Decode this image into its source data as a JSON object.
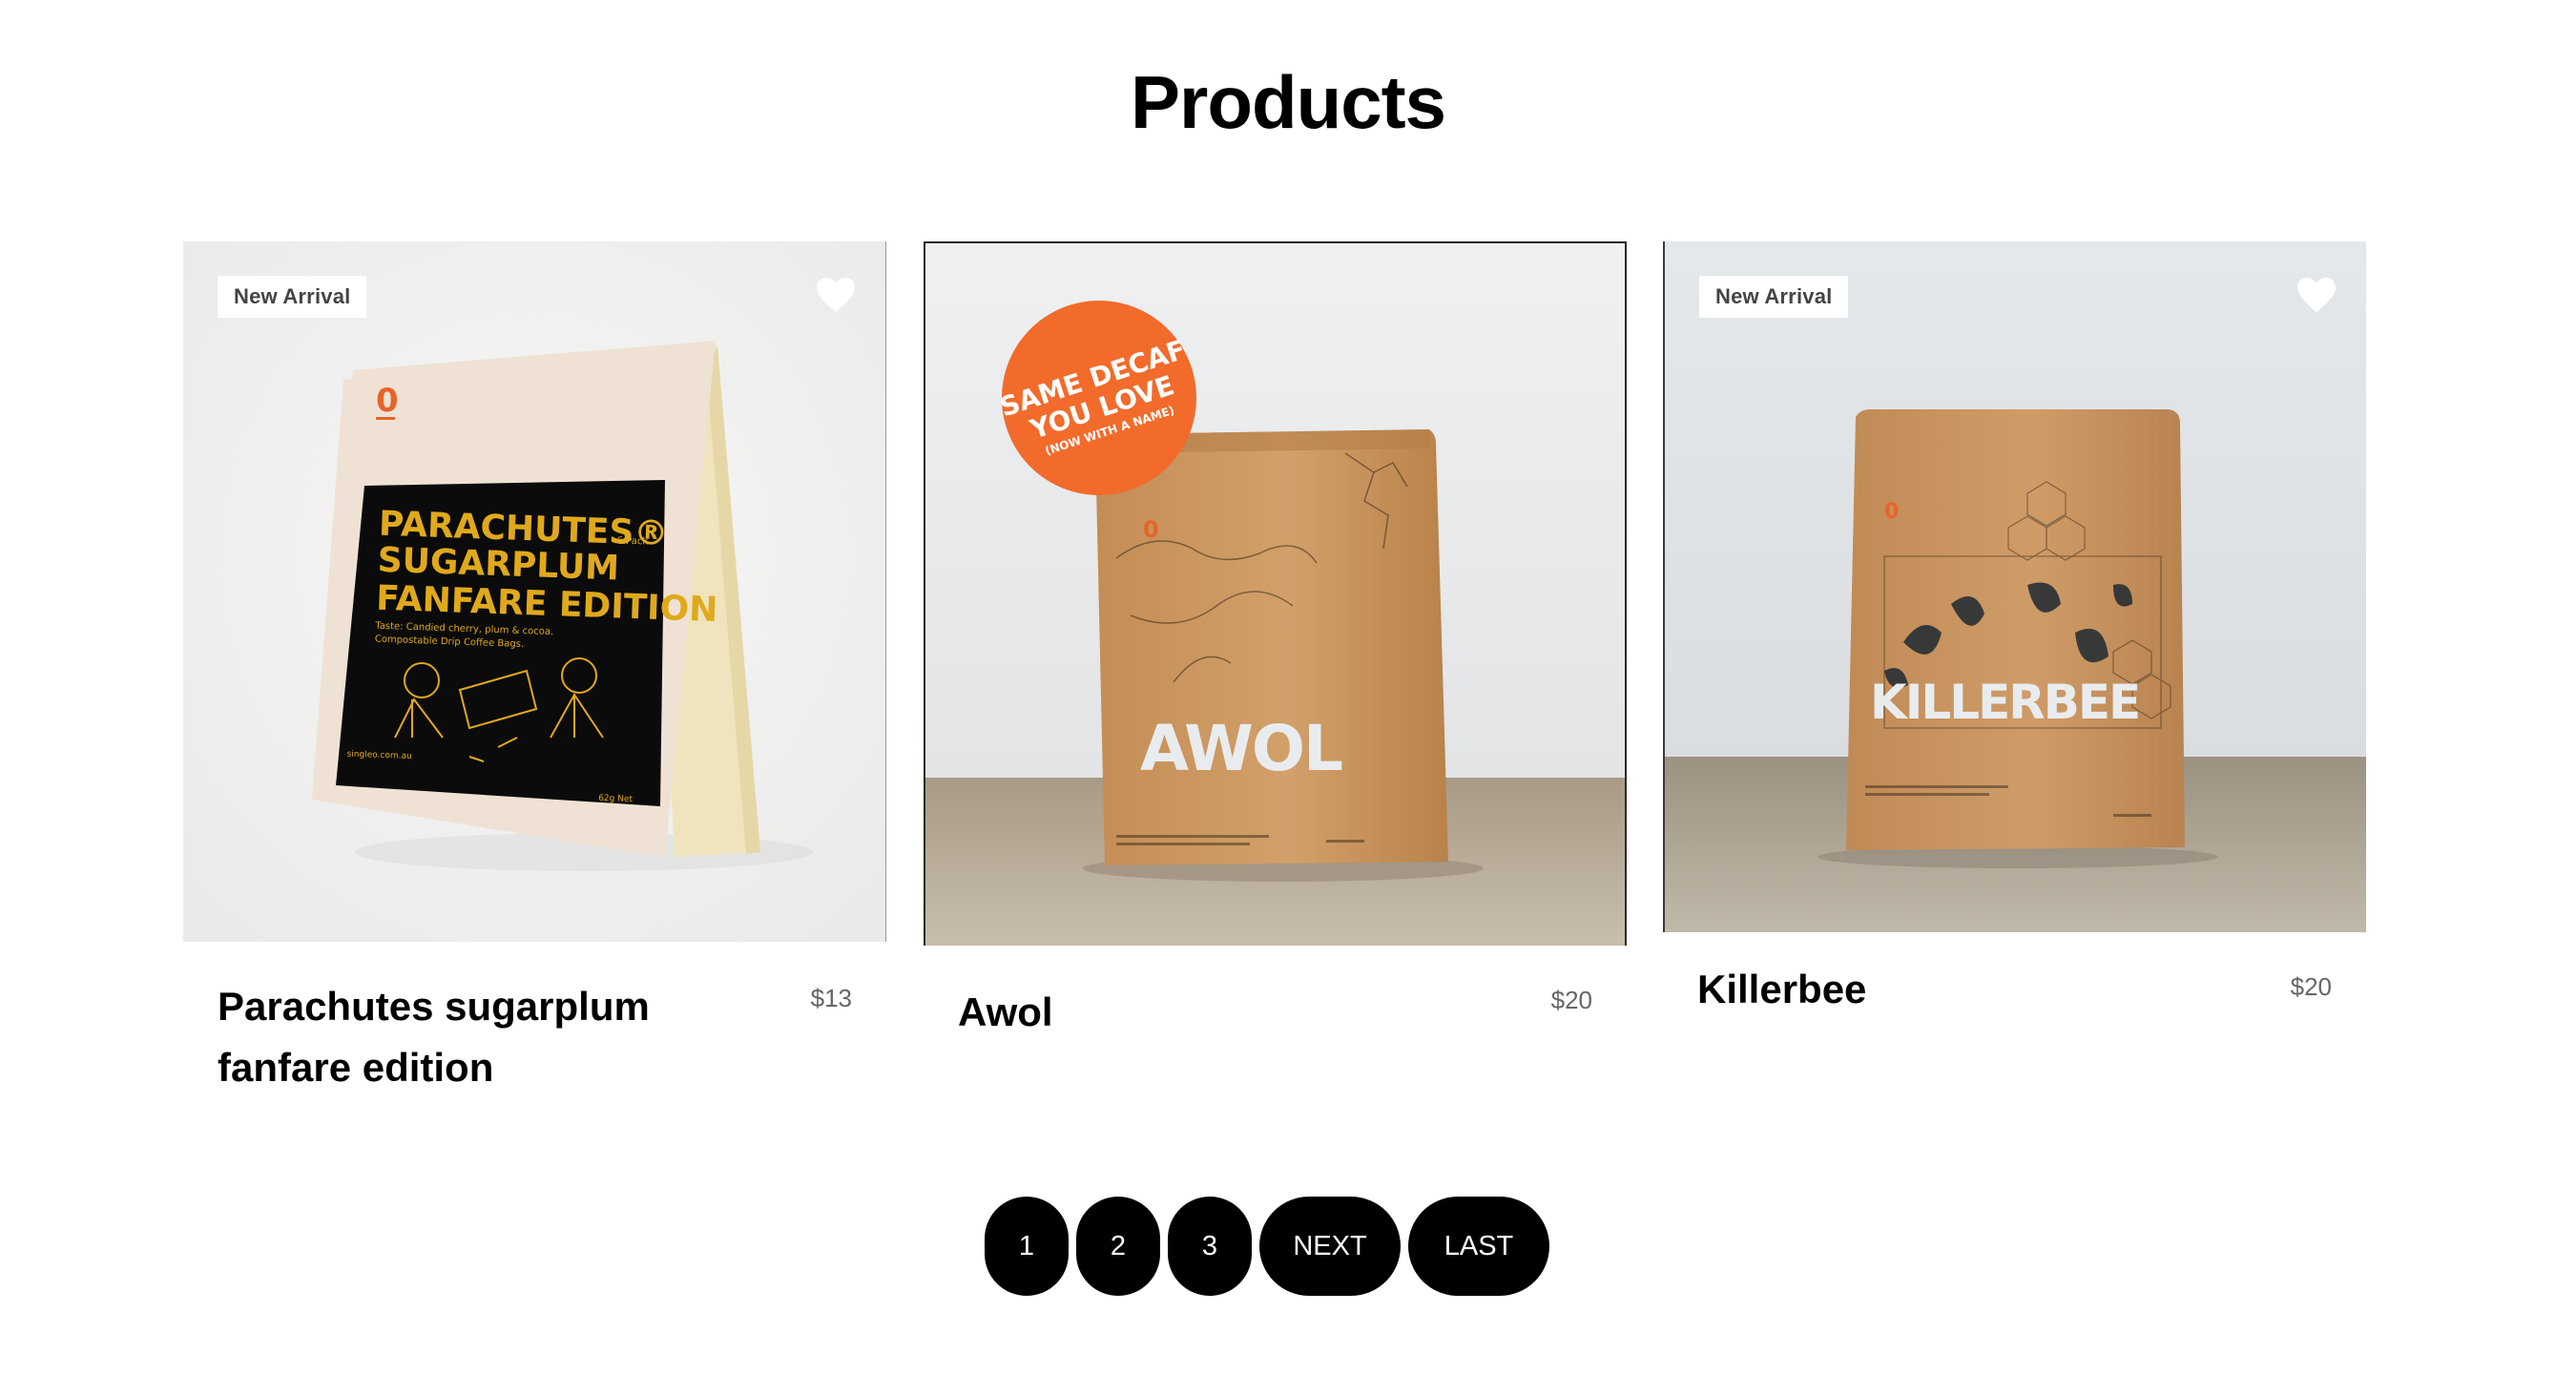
{
  "page": {
    "title": "Products"
  },
  "products": [
    {
      "name": "Parachutes sugarplum fanfare edition",
      "price": "$13",
      "badge": "New Arrival",
      "package_text": {
        "logo": "0",
        "title_lines": [
          "PARACHUTES®",
          "SUGARPLUM",
          "FANFARE EDITION"
        ],
        "pack": "6 Pack",
        "notes": [
          "Taste: Candied cherry, plum & cocoa.",
          "Compostable Drip Coffee Bags."
        ],
        "web": "singleo.com.au",
        "weight": "62g Net"
      }
    },
    {
      "name": "Awol",
      "price": "$20",
      "sticker_lines": [
        "SAME DECAF",
        "YOU LOVE",
        "(NOW WITH A NAME)"
      ],
      "package_text": {
        "logo": "0",
        "bag_name": "AWOL"
      }
    },
    {
      "name": "Killerbee",
      "price": "$20",
      "badge": "New Arrival",
      "package_text": {
        "logo": "0",
        "bag_name": "KILLERBEE"
      }
    }
  ],
  "pagination": {
    "pages": [
      "1",
      "2",
      "3"
    ],
    "next_label": "NEXT",
    "last_label": "LAST"
  },
  "colors": {
    "accent_orange": "#f26b2b",
    "kraft": "#c9935a",
    "button_bg": "#000000"
  }
}
